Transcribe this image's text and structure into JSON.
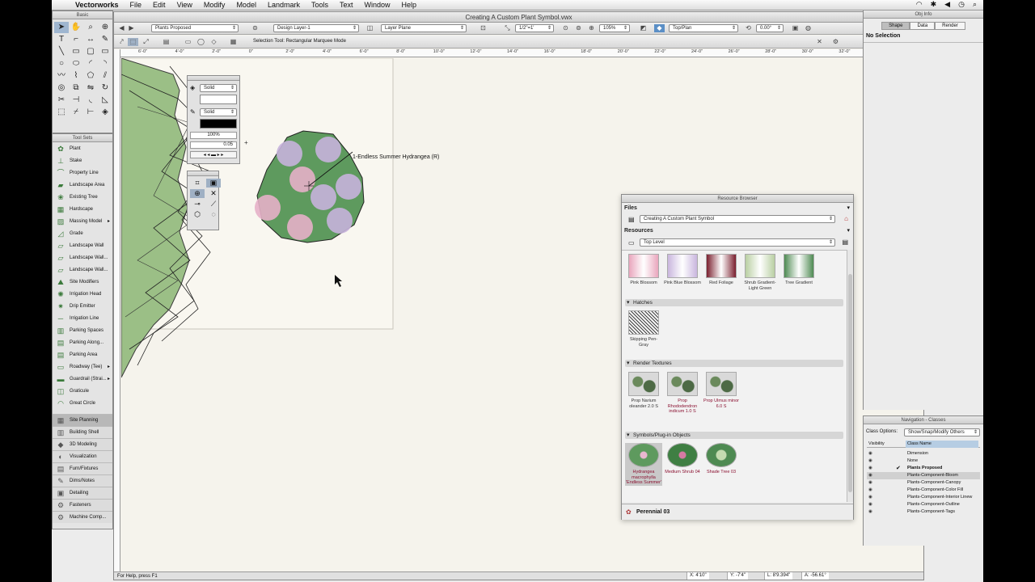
{
  "menubar": {
    "apple_icon": "apple-logo",
    "app_name": "Vectorworks",
    "items": [
      "File",
      "Edit",
      "View",
      "Modify",
      "Model",
      "Landmark",
      "Tools",
      "Text",
      "Window",
      "Help"
    ]
  },
  "basic_palette": {
    "title": "Basic"
  },
  "toolsets": {
    "title": "Tool Sets",
    "items": [
      {
        "label": "Plant"
      },
      {
        "label": "Stake"
      },
      {
        "label": "Property Line"
      },
      {
        "label": "Landscape Area"
      },
      {
        "label": "Existing Tree"
      },
      {
        "label": "Hardscape"
      },
      {
        "label": "Massing Model"
      },
      {
        "label": "Grade"
      },
      {
        "label": "Landscape Wall"
      },
      {
        "label": "Landscape Wall..."
      },
      {
        "label": "Landscape Wall..."
      },
      {
        "label": "Site Modifiers"
      },
      {
        "label": "Irrigation Head"
      },
      {
        "label": "Drip Emitter"
      },
      {
        "label": "Irrigation Line"
      },
      {
        "label": "Parking Spaces"
      },
      {
        "label": "Parking Along..."
      },
      {
        "label": "Parking Area"
      },
      {
        "label": "Roadway (Tee)"
      },
      {
        "label": "Guardrail (Strai..."
      },
      {
        "label": "Graticule"
      },
      {
        "label": "Great Circle"
      }
    ],
    "categories": [
      {
        "label": "Site Planning"
      },
      {
        "label": "Building Shell"
      },
      {
        "label": "3D Modeling"
      },
      {
        "label": "Visualization"
      },
      {
        "label": "Furn/Fixtures"
      },
      {
        "label": "Dims/Notes"
      },
      {
        "label": "Detailing"
      },
      {
        "label": "Fasteners"
      },
      {
        "label": "Machine Comp..."
      }
    ]
  },
  "document": {
    "title": "Creating A Custom Plant Symbol.vwx",
    "class_menu": "Plants Proposed",
    "layer_menu": "Design Layer-1",
    "plane_menu": "Layer Plane",
    "scale": "1/2\"=1'",
    "zoom": "105%",
    "view_menu": "Top/Plan",
    "rotation": "0.00°",
    "mode_text": "Selection Tool: Rectangular Marquee Mode",
    "plant_label": "1-Endless Summer Hydrangea (R)",
    "status_help": "For Help, press F1",
    "coords": {
      "x": "X: 4'10\"",
      "y": "Y: -7'4\"",
      "l": "L: 8'9.394\"",
      "a": "A: -56.61°"
    },
    "ruler_ticks": [
      "6'-0\"",
      "4'-0\"",
      "2'-0\"",
      "0\"",
      "2'-0\"",
      "4'-0\"",
      "6'-0\"",
      "8'-0\"",
      "10'-0\"",
      "12'-0\"",
      "14'-0\"",
      "16'-0\"",
      "18'-0\"",
      "20'-0\"",
      "22'-0\"",
      "24'-0\"",
      "26'-0\"",
      "28'-0\"",
      "30'-0\"",
      "32'-0\""
    ]
  },
  "attributes": {
    "fill_style": "Solid",
    "pen_style": "Solid",
    "opacity": "100%",
    "line_weight": "0.05"
  },
  "resource_browser": {
    "title": "Resource Browser",
    "files_label": "Files",
    "file_value": "Creating A Custom Plant Symbol",
    "resources_label": "Resources",
    "folder_value": "Top Level",
    "gradients": [
      {
        "label": "Pink Blossom",
        "color": "#e9a6bd"
      },
      {
        "label": "Pink Blue Blossom",
        "color": "#c9b6de"
      },
      {
        "label": "Red Foliage",
        "color": "#7a1f2e"
      },
      {
        "label": "Shrub Gradient-Light Green",
        "color": "#b9cfa2"
      },
      {
        "label": "Tree Gradient",
        "color": "#4e8a52"
      }
    ],
    "hatches_header": "Hatches",
    "hatches": [
      {
        "label": "Skipping Pen-Gray"
      }
    ],
    "textures_header": "Render Textures",
    "textures": [
      {
        "label": "Prop Narium oleander 2.0 S"
      },
      {
        "label": "Prop Rhododendron indicum 1.0 S"
      },
      {
        "label": "Prop Ulmus minor 6.0 S"
      }
    ],
    "symbols_header": "Symbols/Plug-in Objects",
    "symbols": [
      {
        "label": "Hydrangea macrophylla 'Endless Summer'"
      },
      {
        "label": "Medium Shrub 04"
      },
      {
        "label": "Shade Tree 03"
      }
    ],
    "footer_item": "Perennial 03"
  },
  "obj_info": {
    "title": "Obj Info",
    "tabs": [
      "Shape",
      "Data",
      "Render"
    ],
    "selection": "No Selection"
  },
  "navigation": {
    "title": "Navigation - Classes",
    "class_options_label": "Class Options:",
    "class_options_value": "Show/Snap/Modify Others",
    "col_visibility": "Visibility",
    "col_class": "Class Name",
    "rows": [
      {
        "name": "Dimension",
        "checked": false
      },
      {
        "name": "None",
        "checked": false
      },
      {
        "name": "Plants Proposed",
        "checked": true
      },
      {
        "name": "Plants-Component-Bloom",
        "checked": false
      },
      {
        "name": "Plants-Component-Canopy",
        "checked": false
      },
      {
        "name": "Plants-Component-Color Fill",
        "checked": false
      },
      {
        "name": "Plants-Component-Interior Linew",
        "checked": false
      },
      {
        "name": "Plants-Component-Outline",
        "checked": false
      },
      {
        "name": "Plants-Component-Tags",
        "checked": false
      }
    ]
  }
}
